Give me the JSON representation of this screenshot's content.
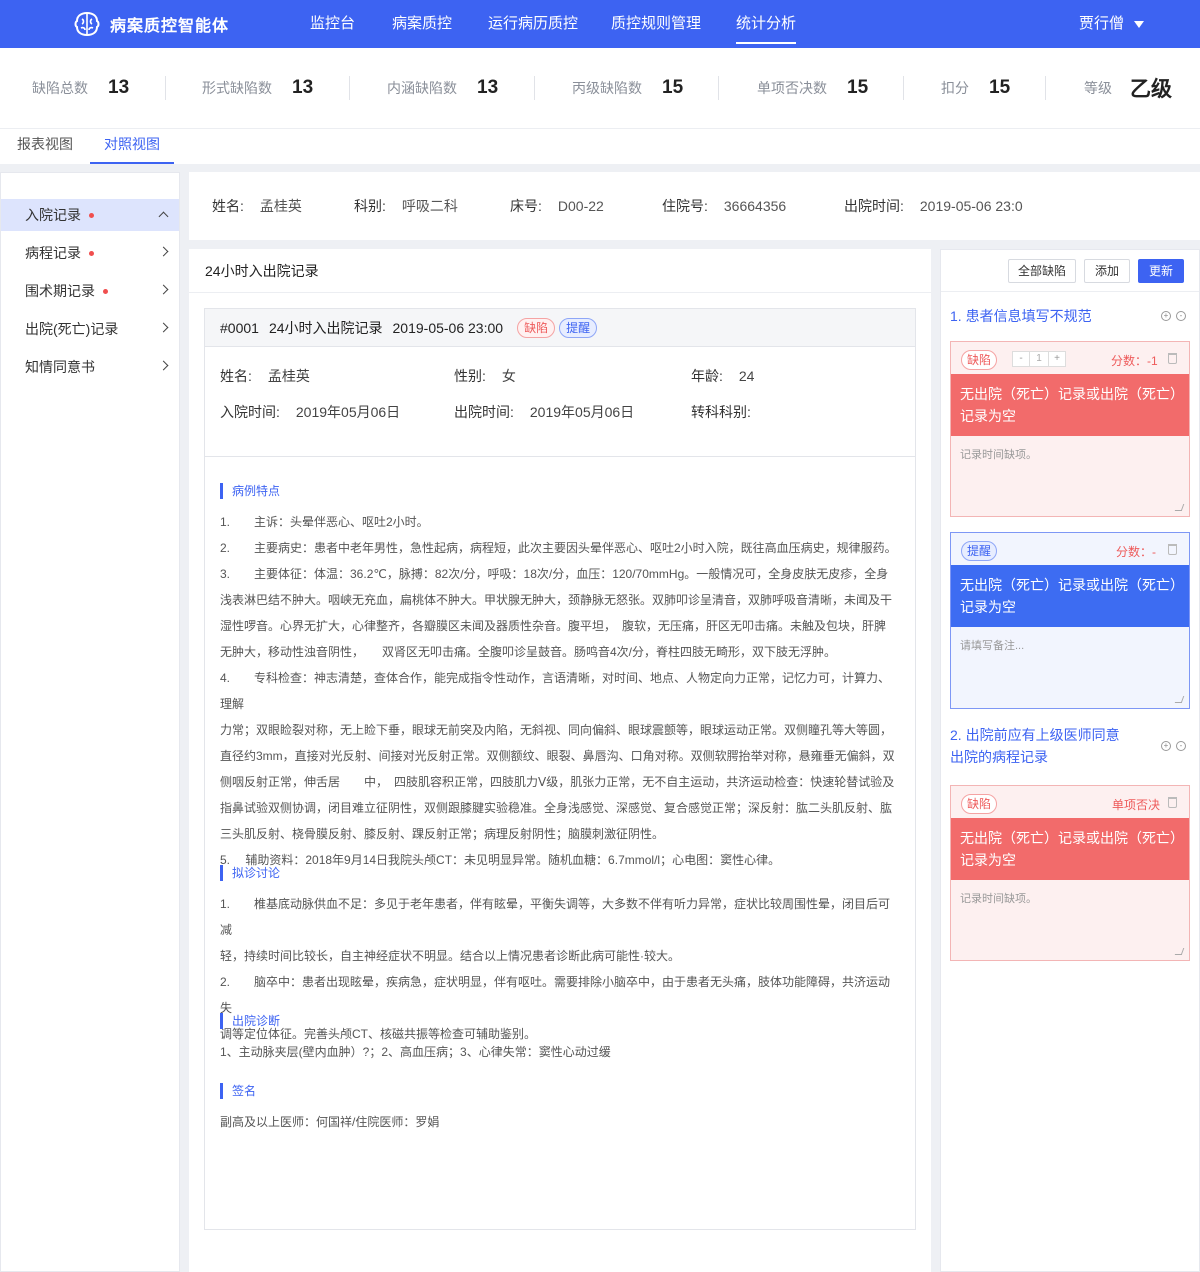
{
  "app": {
    "title": "病案质控智能体",
    "user": "贾行僧"
  },
  "nav": [
    "监控台",
    "病案质控",
    "运行病历质控",
    "质控规则管理",
    "统计分析"
  ],
  "nav_active": "统计分析",
  "stats": [
    {
      "label": "缺陷总数",
      "value": "13"
    },
    {
      "label": "形式缺陷数",
      "value": "13"
    },
    {
      "label": "内涵缺陷数",
      "value": "13"
    },
    {
      "label": "丙级缺陷数",
      "value": "15"
    },
    {
      "label": "单项否决数",
      "value": "15"
    },
    {
      "label": "扣分",
      "value": "15"
    },
    {
      "label": "等级",
      "value": "乙级"
    }
  ],
  "view_tabs": [
    "报表视图",
    "对照视图"
  ],
  "view_tab_active": "对照视图",
  "sidebar": [
    {
      "label": "入院记录",
      "flag": true,
      "expanded": true
    },
    {
      "label": "病程记录",
      "flag": true
    },
    {
      "label": "围术期记录",
      "flag": true
    },
    {
      "label": "出院(死亡)记录",
      "flag": false
    },
    {
      "label": "知情同意书",
      "flag": false
    }
  ],
  "patient": {
    "name_label": "姓名:",
    "name": "孟桂英",
    "dept_label": "科别:",
    "dept": "呼吸二科",
    "bed_label": "床号:",
    "bed": "D00-22",
    "admission_no_label": "住院号:",
    "admission_no": "36664356",
    "discharge_label": "出院时间:",
    "discharge": "2019-05-06  23:0"
  },
  "document": {
    "panel_title": "24小时入出院记录",
    "record_id": "#0001",
    "record_title": "24小时入出院记录",
    "record_time": "2019-05-06  23:00",
    "tag_defect": "缺陷",
    "tag_remind": "提醒",
    "fields": {
      "name_label": "姓名:",
      "name": "孟桂英",
      "sex_label": "性别:",
      "sex": "女",
      "age_label": "年龄:",
      "age": "24",
      "in_label": "入院时间:",
      "in_time": "2019年05月06日",
      "out_label": "出院时间:",
      "out_time": "2019年05月06日",
      "transfer_label": "转科科别:"
    },
    "sections": [
      {
        "title": "病例特点"
      },
      {
        "title": "拟诊讨论"
      },
      {
        "title": "出院诊断"
      },
      {
        "title": "签名"
      }
    ],
    "case_lines": [
      "1.　　主诉：头晕伴恶心、呕吐2小时。",
      "2.　　主要病史：患者中老年男性，急性起病，病程短，此次主要因头晕伴恶心、呕吐2小时入院，既往高血压病史，规律服药。",
      "3.　　主要体征：体温：36.2℃，脉搏：82次/分，呼吸：18次/分，血压：120/70mmHg。一般情况可，全身皮肤无皮疹，全身",
      "浅表淋巴结不肿大。咽峡无充血，扁桃体不肿大。甲状腺无肿大，颈静脉无怒张。双肺叩诊呈清音，双肺呼吸音清晰，未闻及干",
      "湿性啰音。心界无扩大，心律整齐，各瓣膜区未闻及器质性杂音。腹平坦，　腹软，无压痛，肝区无叩击痛。未触及包块，肝脾",
      "无肿大，移动性浊音阴性，　　双肾区无叩击痛。全腹叩诊呈鼓音。肠鸣音4次/分，脊柱四肢无畸形，双下肢无浮肿。",
      "4.　　专科检查：神志清楚，查体合作，能完成指令性动作，言语清晰，对时间、地点、人物定向力正常，记忆力可，计算力、理解",
      "力常；双眼睑裂对称，无上睑下垂，眼球无前突及内陷，无斜视、同向偏斜、眼球震颤等，眼球运动正常。双侧瞳孔等大等圆，",
      "直径约3mm，直接对光反射、间接对光反射正常。双侧额纹、眼裂、鼻唇沟、口角对称。双侧软腭抬举对称，悬雍垂无偏斜，双",
      "侧咽反射正常，伸舌居　　中，　四肢肌容积正常，四肢肌力Ⅴ级，肌张力正常，无不自主运动，共济运动检查：快速轮替试验及",
      "指鼻试验双侧协调，闭目难立征阴性，双侧跟膝腱实验稳准。全身浅感觉、深感觉、复合感觉正常；深反射：肱二头肌反射、肱",
      "三头肌反射、桡骨膜反射、膝反射、踝反射正常；病理反射阴性；脑膜刺激征阴性。",
      " 5.　 辅助资料：2018年9月14日我院头颅CT：未见明显异常。随机血糖：6.7mmol/l；心电图：窦性心律。"
    ],
    "discussion_lines": [
      "1.　　椎基底动脉供血不足：多见于老年患者，伴有眩晕，平衡失调等，大多数不伴有听力异常，症状比较周围性晕，闭目后可减",
      "轻，持续时间比较长，自主神经症状不明显。结合以上情况患者诊断此病可能性·较大。",
      "2.　　脑卒中：患者出现眩晕，疾病急，症状明显，伴有呕吐。需要排除小脑卒中，由于患者无头痛，肢体功能障碍，共济运动失",
      "调等定位体征。完善头颅CT、核磁共振等检查可辅助鉴别。"
    ],
    "diagnosis": "1、主动脉夹层(壁内血肿）?；2、高血压病；3、心律失常：窦性心动过缓",
    "signature": "副高及以上医师：何国祥/住院医师：罗娟"
  },
  "right_panel": {
    "buttons": {
      "all_defects": "全部缺陷",
      "add": "添加",
      "update": "更新"
    },
    "issues": [
      {
        "title": "1. 患者信息填写不规范",
        "cards": [
          {
            "tag": "缺陷",
            "stepper": {
              "minus": "-",
              "value": "1",
              "plus": "+"
            },
            "score": "分数：-1",
            "message": "无出院（死亡）记录或出院（死亡）记录为空",
            "note": "记录时间缺项。"
          },
          {
            "tag": "提醒",
            "score": "分数：-",
            "message": "无出院（死亡）记录或出院（死亡）记录为空",
            "note": "请填写备注..."
          }
        ]
      },
      {
        "title": "2. 出院前应有上级医师同意出院的病程记录",
        "cards": [
          {
            "tag": "缺陷",
            "score": "单项否决",
            "message": "无出院（死亡）记录或出院（死亡）记录为空",
            "note": "记录时间缺项。"
          }
        ]
      }
    ]
  },
  "colors": {
    "primary": "#3d63f2",
    "defect_red": "#f26b6b",
    "remind_blue": "#3d6cf2"
  },
  "icons": [
    "brain-logo-icon",
    "caret-down-icon",
    "chevron-up-icon",
    "chevron-right-icon",
    "plus-circle-icon",
    "minus-circle-icon",
    "trash-icon",
    "resize-handle-icon"
  ]
}
